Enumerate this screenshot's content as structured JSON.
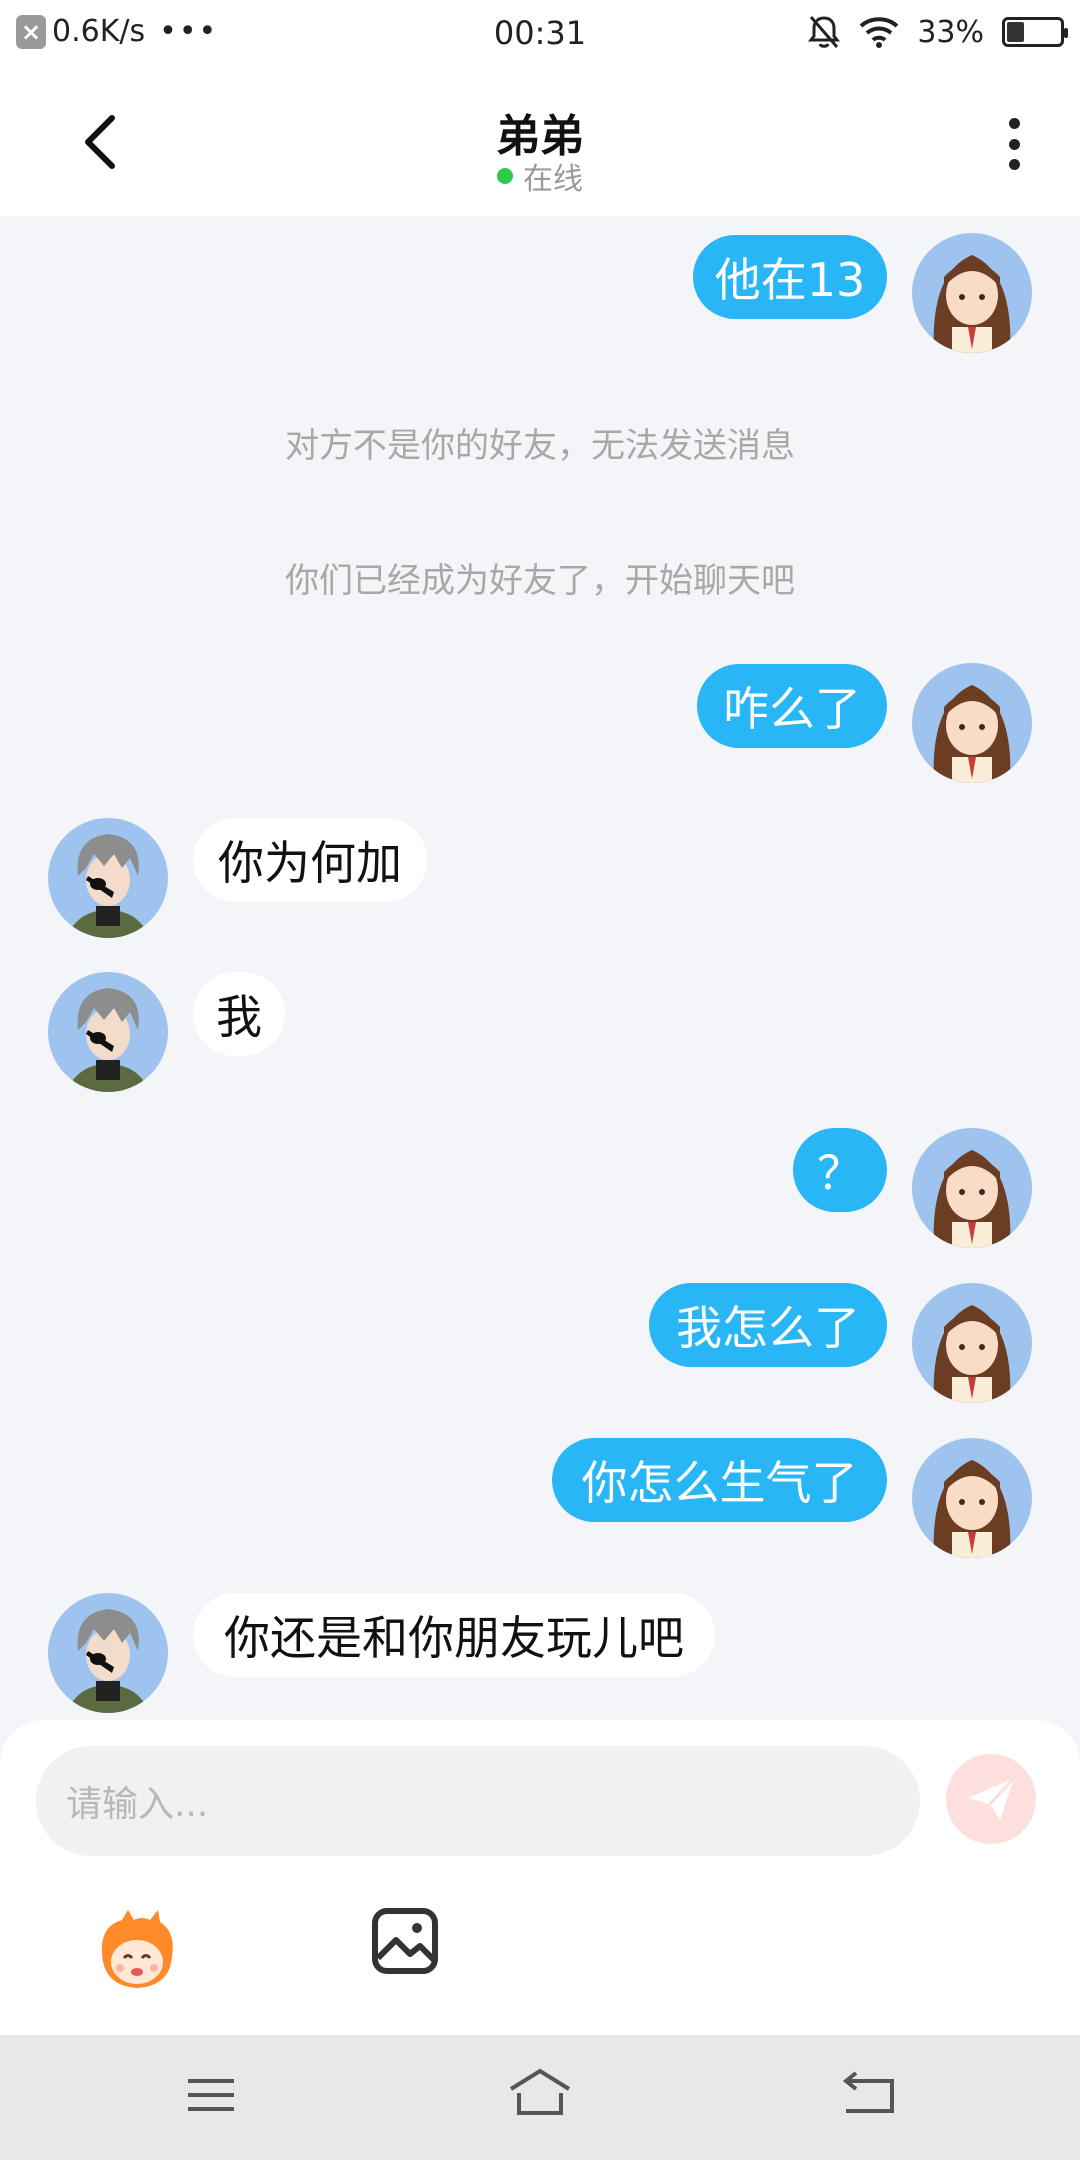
{
  "status_bar": {
    "speed": "0.6K/s",
    "more": "•••",
    "time": "00:31",
    "battery": "33%",
    "battery_level": 0.33
  },
  "header": {
    "title": "弟弟",
    "status": "在线",
    "status_color": "#2ecb4d"
  },
  "messages": [
    {
      "side": "out",
      "text": "他在13"
    },
    {
      "side": "system",
      "text": "对方不是你的好友，无法发送消息"
    },
    {
      "side": "system",
      "text": "你们已经成为好友了，开始聊天吧"
    },
    {
      "side": "out",
      "text": "咋么了"
    },
    {
      "side": "in",
      "text": "你为何加"
    },
    {
      "side": "in",
      "text": "我"
    },
    {
      "side": "out",
      "text": "？"
    },
    {
      "side": "out",
      "text": "我怎么了"
    },
    {
      "side": "out",
      "text": "你怎么生气了"
    },
    {
      "side": "in",
      "text": "你还是和你朋友玩儿吧"
    }
  ],
  "composer": {
    "placeholder": "请输入...",
    "send_icon": "paper-plane-icon",
    "tools": [
      "sticker-icon",
      "image-icon"
    ]
  },
  "colors": {
    "outgoing_bubble": "#29b6f6",
    "incoming_bubble": "#ffffff",
    "background": "#f4f5f8"
  },
  "nav": [
    "menu-icon",
    "home-icon",
    "back-icon"
  ]
}
